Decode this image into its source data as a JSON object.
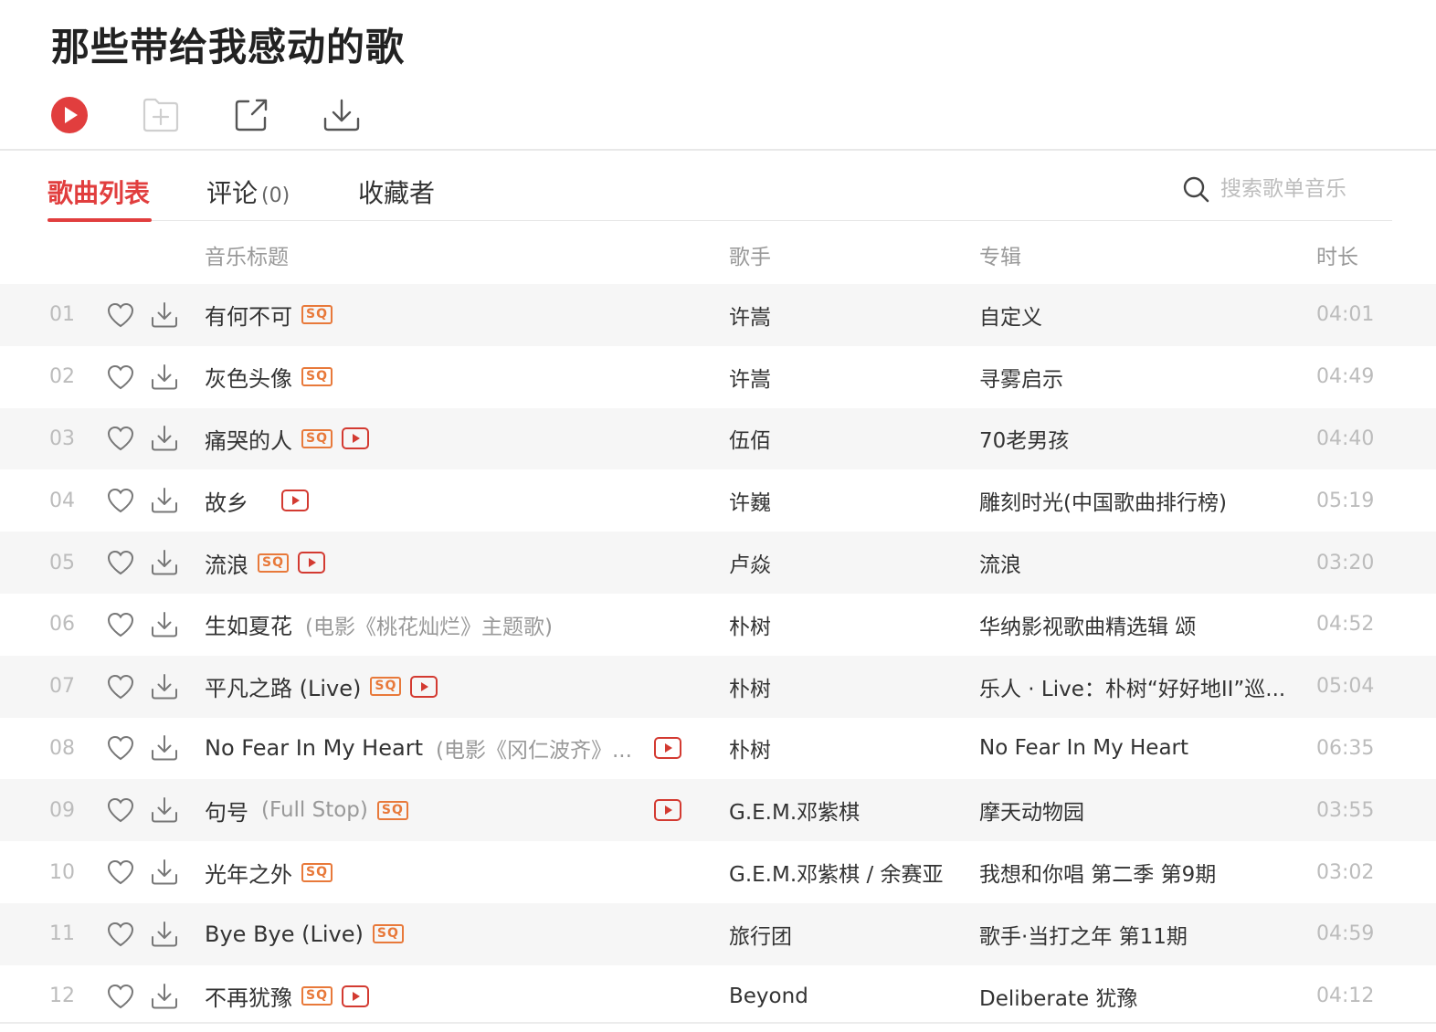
{
  "page": {
    "title": "那些带给我感动的歌"
  },
  "actions": {
    "play_icon": "play-circle-icon",
    "add_icon": "folder-add-icon",
    "share_icon": "share-icon",
    "download_icon": "download-icon"
  },
  "tabs": {
    "songs": "歌曲列表",
    "comments": "评论",
    "comments_count": "(0)",
    "collectors": "收藏者"
  },
  "search": {
    "placeholder": "搜索歌单音乐"
  },
  "columns": {
    "title": "音乐标题",
    "singer": "歌手",
    "album": "专辑",
    "duration": "时长"
  },
  "colors": {
    "accent": "#e13e3e",
    "sq_badge": "#e8793a",
    "mv_badge": "#d33a31"
  },
  "songs": [
    {
      "index": "01",
      "title": "有何不可",
      "subtitle": "",
      "sq": true,
      "mv": false,
      "singer": "许嵩",
      "album": "自定义",
      "duration": "04:01"
    },
    {
      "index": "02",
      "title": "灰色头像",
      "subtitle": "",
      "sq": true,
      "mv": false,
      "singer": "许嵩",
      "album": "寻雾启示",
      "duration": "04:49"
    },
    {
      "index": "03",
      "title": "痛哭的人",
      "subtitle": "",
      "sq": true,
      "mv": true,
      "singer": "伍佰",
      "album": "70老男孩",
      "duration": "04:40"
    },
    {
      "index": "04",
      "title": "故乡",
      "subtitle": "",
      "sq": false,
      "mv": true,
      "singer": "许巍",
      "album": "雕刻时光(中国歌曲排行榜)",
      "duration": "05:19"
    },
    {
      "index": "05",
      "title": "流浪",
      "subtitle": "",
      "sq": true,
      "mv": true,
      "singer": "卢焱",
      "album": "流浪",
      "duration": "03:20"
    },
    {
      "index": "06",
      "title": "生如夏花",
      "subtitle": "(电影《桃花灿烂》主题歌)",
      "sq": false,
      "mv": false,
      "singer": "朴树",
      "album": "华纳影视歌曲精选辑 颂",
      "duration": "04:52"
    },
    {
      "index": "07",
      "title": "平凡之路 (Live)",
      "subtitle": "",
      "sq": true,
      "mv": true,
      "singer": "朴树",
      "album": "乐人 · Live：朴树“好好地II”巡...",
      "duration": "05:04"
    },
    {
      "index": "08",
      "title": "No Fear In My Heart",
      "subtitle": "(电影《冈仁波齐》...",
      "sq": false,
      "mv": true,
      "singer": "朴树",
      "album": "No Fear In My Heart",
      "duration": "06:35"
    },
    {
      "index": "09",
      "title": "句号",
      "subtitle": "(Full Stop)",
      "sq": true,
      "mv": true,
      "singer": "G.E.M.邓紫棋",
      "album": "摩天动物园",
      "duration": "03:55"
    },
    {
      "index": "10",
      "title": "光年之外",
      "subtitle": "",
      "sq": true,
      "mv": false,
      "singer": "G.E.M.邓紫棋 / 余赛亚",
      "album": "我想和你唱 第二季 第9期",
      "duration": "03:02"
    },
    {
      "index": "11",
      "title": "Bye Bye (Live)",
      "subtitle": "",
      "sq": true,
      "mv": false,
      "singer": "旅行团",
      "album": "歌手·当打之年 第11期",
      "duration": "04:59"
    },
    {
      "index": "12",
      "title": "不再犹豫",
      "subtitle": "",
      "sq": true,
      "mv": true,
      "singer": "Beyond",
      "album": "Deliberate 犹豫",
      "duration": "04:12"
    }
  ],
  "badges": {
    "sq_label": "SQ"
  }
}
